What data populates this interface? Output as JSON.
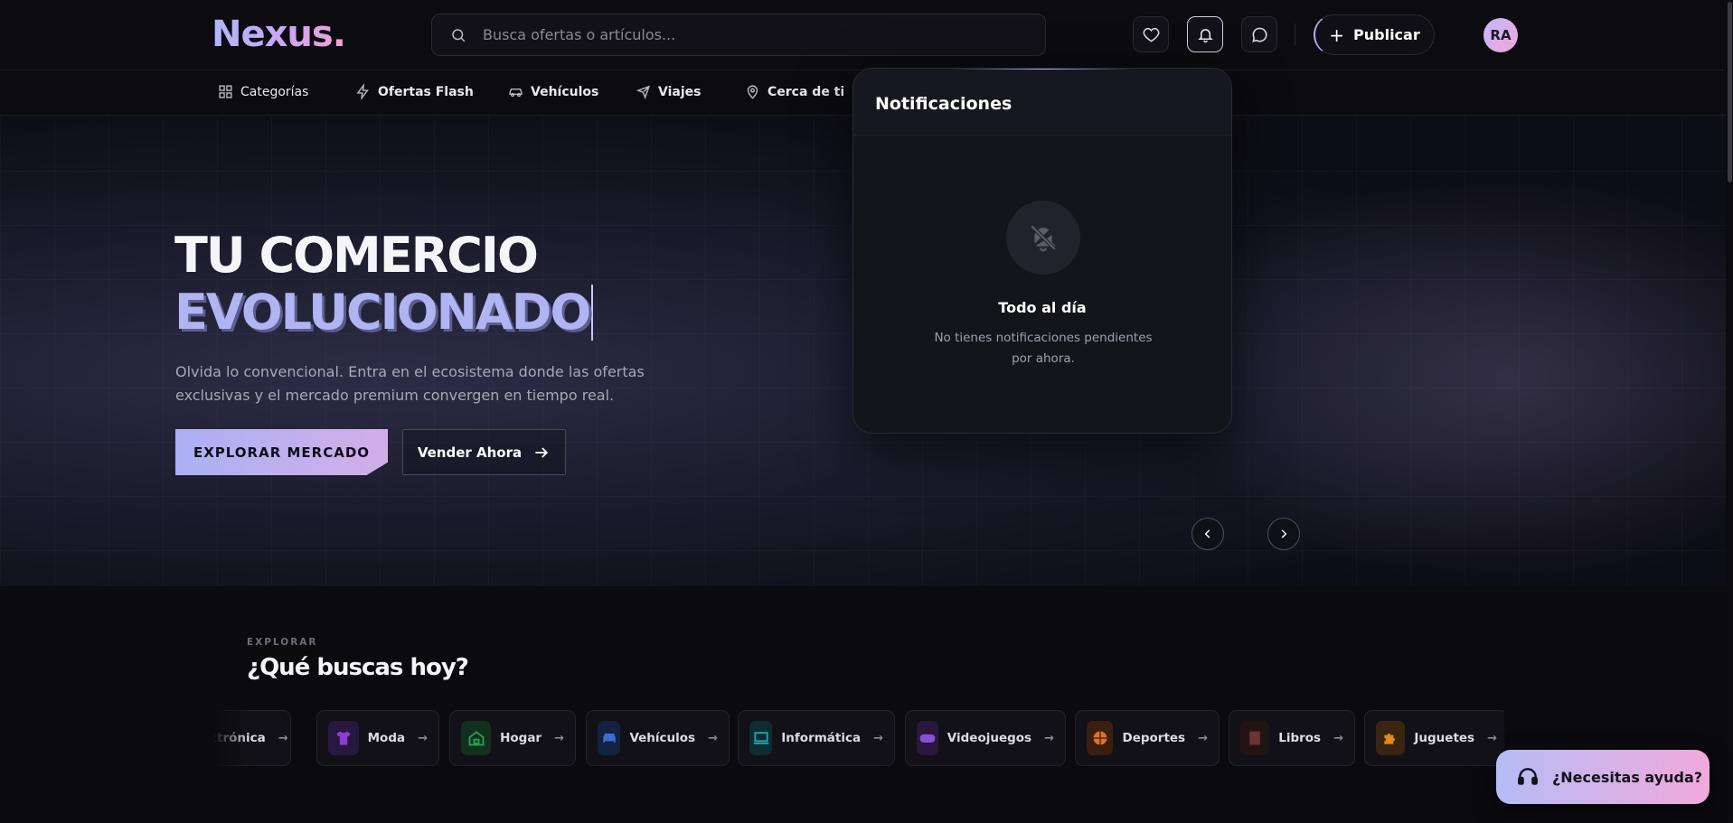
{
  "brand": {
    "logo": "Nexus."
  },
  "search": {
    "placeholder": "Busca ofertas o artículos..."
  },
  "header": {
    "publish_label": "Publicar",
    "avatar_initials": "RA"
  },
  "nav": {
    "items": [
      {
        "label": "Categorías",
        "icon": "grid-icon"
      },
      {
        "label": "Ofertas Flash",
        "icon": "lightning-icon"
      },
      {
        "label": "Vehículos",
        "icon": "car-icon"
      },
      {
        "label": "Viajes",
        "icon": "plane-icon"
      },
      {
        "label": "Cerca de ti",
        "icon": "map-pin-icon"
      }
    ]
  },
  "hero": {
    "title_line1": "TU COMERCIO",
    "title_line2": "EVOLUCIONADO",
    "subtitle": "Olvida lo convencional. Entra en el ecosistema donde las ofertas exclusivas y el mercado premium convergen en tiempo real.",
    "cta_primary": "EXPLORAR MERCADO",
    "cta_secondary": "Vender Ahora"
  },
  "notifications": {
    "title": "Notificaciones",
    "empty_title": "Todo al día",
    "empty_text": "No tienes notificaciones pendientes por ahora."
  },
  "explore": {
    "kicker": "EXPLORAR",
    "title": "¿Qué buscas hoy?",
    "categories": [
      {
        "label": "Electrónica",
        "color": "#6b7280"
      },
      {
        "label": "Moda",
        "color": "#8b3fd1"
      },
      {
        "label": "Hogar",
        "color": "#22a455"
      },
      {
        "label": "Vehículos",
        "color": "#3b6fd6"
      },
      {
        "label": "Informática",
        "color": "#1fa3b3"
      },
      {
        "label": "Videojuegos",
        "color": "#8b4fd1"
      },
      {
        "label": "Deportes",
        "color": "#e0702a"
      },
      {
        "label": "Libros",
        "color": "#7a3a3a"
      },
      {
        "label": "Juguetes",
        "color": "#e08a1f"
      }
    ]
  },
  "help": {
    "label": "¿Necesitas ayuda?"
  },
  "colors": {
    "accent_start": "#aab1f4",
    "accent_end": "#f1a9db",
    "background": "#0a0a0f"
  }
}
